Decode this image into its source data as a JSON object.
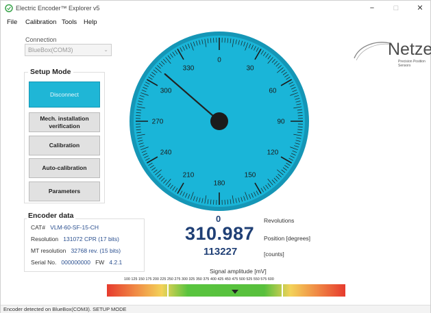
{
  "window": {
    "title": "Electric Encoder™ Explorer v5",
    "minimize": "−",
    "maximize": "□",
    "close": "✕"
  },
  "menu": [
    "File",
    "Calibration",
    "Tools",
    "Help"
  ],
  "connection": {
    "label": "Connection",
    "value": "BlueBox(COM3)"
  },
  "setup": {
    "title": "Setup Mode",
    "buttons": [
      "Disconnect",
      "Mech. installation verification",
      "Calibration",
      "Auto-calibration",
      "Parameters"
    ]
  },
  "logo": {
    "name": "Netzer",
    "tagline": "Precision Position Sensors"
  },
  "gauge": {
    "labels": [
      "0",
      "30",
      "60",
      "90",
      "120",
      "150",
      "180",
      "210",
      "240",
      "270",
      "300",
      "330"
    ],
    "needle_degrees": 310.987,
    "face_color": "#1ab5d8"
  },
  "encoder": {
    "title": "Encoder data",
    "cat_label": "CAT#",
    "cat_value": "VLM-60-SF-15-CH",
    "resolution_label": "Resolution",
    "resolution_value": "131072 CPR (17 bits)",
    "mt_label": "MT resolution",
    "mt_value": "32768 rev. (15 bits)",
    "serial_label": "Serial No.",
    "serial_value": "000000000",
    "fw_label": "FW",
    "fw_value": "4.2.1"
  },
  "readout": {
    "revolutions": "0",
    "revolutions_label": "Revolutions",
    "position": "310.987",
    "position_label": "Position [degrees]",
    "counts": "113227",
    "counts_label": "[counts]"
  },
  "signal": {
    "label": "Signal amplitude [mV]",
    "ticks": "100 125 150 175 200 225 250 275 300 325 350 375 400 425 450 475 500 525 550 575 600",
    "marker_value_mv": 375
  },
  "status": "Encoder detected on BlueBox(COM3). SETUP MODE"
}
